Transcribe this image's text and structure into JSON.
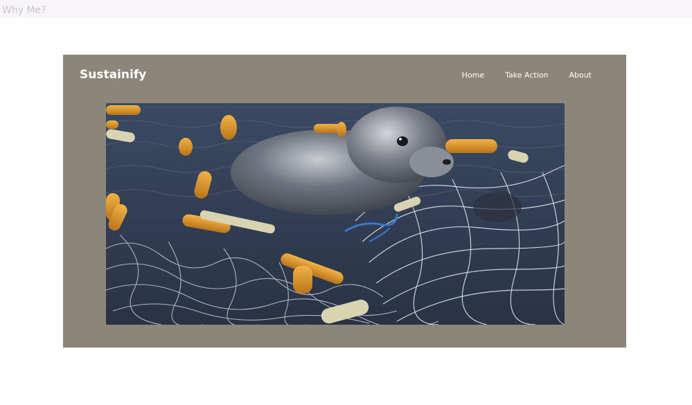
{
  "page": {
    "tab_title": "Why Me?"
  },
  "header": {
    "brand": "Sustainify",
    "nav": [
      {
        "label": "Home"
      },
      {
        "label": "Take Action"
      },
      {
        "label": "About"
      }
    ]
  },
  "hero": {
    "image_icon": "seal-in-fishing-nets-photo"
  },
  "colors": {
    "hero_background": "#8b857a",
    "page_background": "#ffffff",
    "top_bar": "#f7f5f7"
  }
}
